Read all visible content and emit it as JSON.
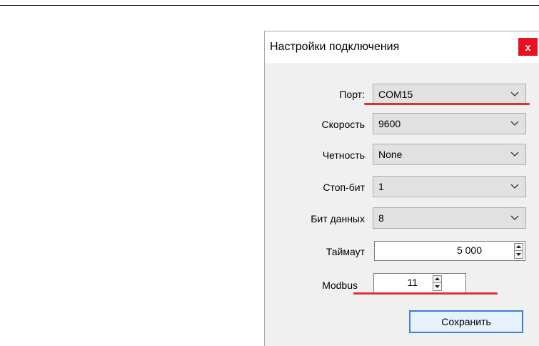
{
  "dialog": {
    "title": "Настройки подключения",
    "close_label": "x"
  },
  "fields": {
    "port": {
      "label": "Порт:",
      "value": "COM15"
    },
    "speed": {
      "label": "Скорость",
      "value": "9600"
    },
    "parity": {
      "label": "Четность",
      "value": "None"
    },
    "stop_bits": {
      "label": "Стоп-бит",
      "value": "1"
    },
    "data_bits": {
      "label": "Бит данных",
      "value": "8"
    },
    "timeout": {
      "label": "Таймаут",
      "value": "5 000"
    },
    "modbus": {
      "label": "Modbus",
      "value": "11"
    }
  },
  "save_label": "Сохранить",
  "colors": {
    "close_button": "#e81123",
    "highlight_underline": "#e0302f",
    "save_border": "#3c7fd6"
  }
}
